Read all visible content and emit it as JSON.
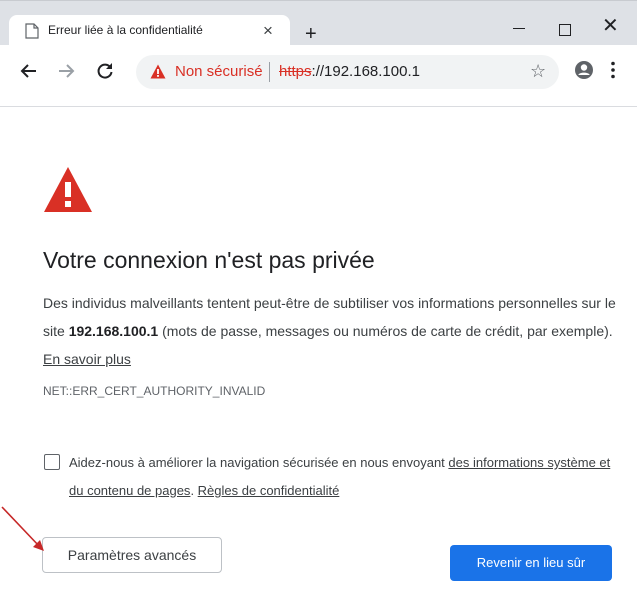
{
  "tab": {
    "title": "Erreur liée à la confidentialité",
    "close_glyph": "×"
  },
  "new_tab_glyph": "+",
  "window": {
    "close_glyph": "✕"
  },
  "omnibox": {
    "security_label": "Non sécurisé",
    "url_scheme": "https",
    "url_rest": "://192.168.100.1",
    "star_glyph": "☆"
  },
  "page": {
    "heading": "Votre connexion n'est pas privée",
    "desc_part1": "Des individus malveillants tentent peut-être de subtiliser vos informations personnelles sur le site ",
    "desc_host": "192.168.100.1",
    "desc_part2": " (mots de passe, messages ou numéros de carte de crédit, par exemple). ",
    "learn_more": "En savoir plus",
    "error_code": "NET::ERR_CERT_AUTHORITY_INVALID",
    "optin_part1": "Aidez-nous à améliorer la navigation sécurisée en nous envoyant ",
    "optin_link1": "des informations système et du contenu de pages",
    "optin_part2": ". ",
    "optin_link2": "Règles de confidentialité",
    "advanced_button": "Paramètres avancés",
    "back_button": "Revenir en lieu sûr"
  },
  "colors": {
    "warning_red": "#d93025",
    "primary_blue": "#1a73e8",
    "annotation_arrow": "#c62828"
  }
}
